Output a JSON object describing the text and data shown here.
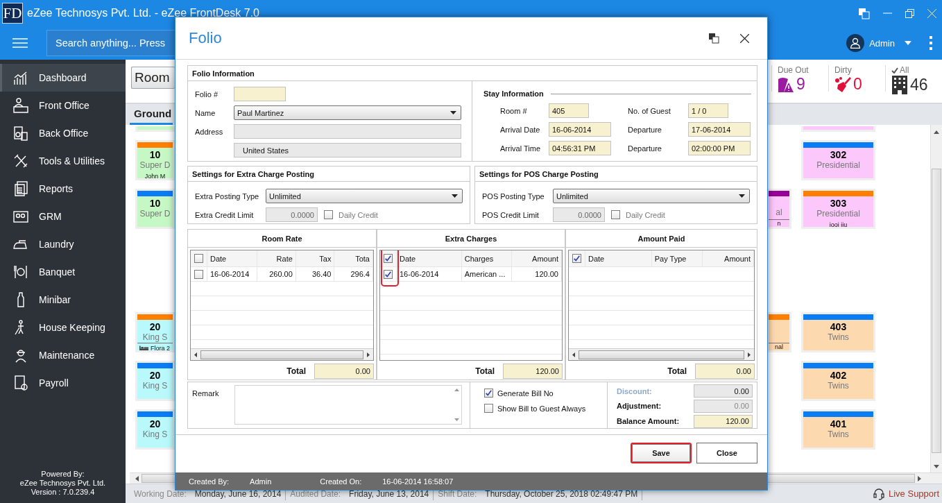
{
  "window": {
    "logo": "FD",
    "title": "eZee Technosys Pvt. Ltd. - eZee FrontDesk 7.0"
  },
  "header": {
    "search_placeholder": "Search anything... Press",
    "user": "Admin"
  },
  "sidebar": {
    "items": [
      {
        "label": "Dashboard",
        "selected": true
      },
      {
        "label": "Front Office",
        "selected": false
      },
      {
        "label": "Back Office",
        "selected": false
      },
      {
        "label": "Tools & Utilities",
        "selected": false
      },
      {
        "label": "Reports",
        "selected": false
      },
      {
        "label": "GRM",
        "selected": false
      },
      {
        "label": "Laundry",
        "selected": false
      },
      {
        "label": "Banquet",
        "selected": false
      },
      {
        "label": "Minibar",
        "selected": false
      },
      {
        "label": "House Keeping",
        "selected": false
      },
      {
        "label": "Maintenance",
        "selected": false
      },
      {
        "label": "Payroll",
        "selected": false
      }
    ],
    "footer": [
      "Powered By:",
      "eZee Technosys Pvt. Ltd.",
      "Version : 7.0.239.4"
    ]
  },
  "toolbar": {
    "view_button": "Room",
    "stats": [
      {
        "kind": "due_out",
        "label": "Due Out",
        "value": "9",
        "color": "#9a1aa0"
      },
      {
        "kind": "dirty",
        "label": "Dirty",
        "value": "0",
        "color": "#e0103a"
      },
      {
        "kind": "all",
        "label": "All",
        "value": "46",
        "color": "#333333"
      }
    ]
  },
  "floor_tabs": [
    {
      "label": "Ground",
      "selected": true
    }
  ],
  "board": {
    "blocks": [
      {
        "rows": [
          {
            "left": {
              "kind": "partial",
              "color": "#c6f8c6"
            },
            "right": {
              "kind": "partial",
              "color": "#fcc8fc"
            }
          },
          {
            "left": {
              "kind": "room",
              "number": "10",
              "type": "Super D",
              "guest": "John M",
              "color": "#c6f8c6",
              "occupied": false,
              "status": {
                "color": "#ff7f00"
              }
            },
            "right": {
              "kind": "room",
              "number": "302",
              "type": "Presidential",
              "color": "#fcc8fc",
              "occupied": false,
              "status": {
                "color": "#0a7df5"
              }
            }
          },
          {
            "left": {
              "kind": "room",
              "number": "10",
              "type": "Super D",
              "color": "#c6f8c6",
              "occupied": false,
              "status": {
                "color": "#0a7df5"
              }
            },
            "middle": {
              "kind": "room",
              "type": "al",
              "guest": "n",
              "color": "#fcc8fc",
              "occupied": true,
              "status": {
                "color": "#990099"
              }
            },
            "right": {
              "kind": "room",
              "number": "303",
              "type": "Presidential",
              "guest": "iooi iiu",
              "color": "#fcc8fc",
              "occupied": false,
              "status": {
                "color": "#ff7f00"
              }
            }
          }
        ]
      },
      {
        "rows": [
          {
            "left": {
              "kind": "room",
              "number": "20",
              "type": "King S",
              "guest": "Flora 2",
              "color": "#b9f9fb",
              "occupied": true,
              "status": {
                "color": "#ff7f00"
              }
            },
            "middle": {
              "kind": "room",
              "guest": "nal",
              "color": "#fdd9b0",
              "occupied": true,
              "status": {
                "color": "#ff7f00"
              }
            },
            "right": {
              "kind": "room",
              "number": "403",
              "type": "Twins",
              "color": "#fdd9b0",
              "occupied": false,
              "status": {
                "color": "#0a7df5"
              }
            }
          },
          {
            "left": {
              "kind": "room",
              "number": "20",
              "type": "King S",
              "color": "#b9f9fb",
              "occupied": false,
              "status": {
                "color": "#0a7df5"
              }
            },
            "right": {
              "kind": "room",
              "number": "402",
              "type": "Twins",
              "color": "#fdd9b0",
              "occupied": false,
              "status": {
                "color": "#0a7df5"
              }
            }
          },
          {
            "left": {
              "kind": "room",
              "number": "20",
              "type": "King S",
              "color": "#b9f9fb",
              "occupied": false,
              "status": {
                "color": "#0a7df5"
              }
            },
            "right": {
              "kind": "room",
              "number": "401",
              "type": "Twins",
              "color": "#fdd9b0",
              "occupied": false,
              "status": {
                "color": "#0a7df5"
              }
            }
          }
        ]
      }
    ]
  },
  "dialog": {
    "title": "Folio",
    "folio_information": {
      "heading": "Folio Information",
      "folio_label": "Folio #",
      "name_label": "Name",
      "name_value": "Paul Martinez",
      "address_label": "Address",
      "country": "United States"
    },
    "stay_information": {
      "heading": "Stay Information",
      "fields": [
        {
          "label": "Room #",
          "value": "405"
        },
        {
          "label": "No. of Guest",
          "value": "1 / 0"
        },
        {
          "label": "Arrival Date",
          "value": "16-06-2014"
        },
        {
          "label": "Departure",
          "value": "17-06-2014"
        },
        {
          "label": "Arrival Time",
          "value": "04:56:31 PM"
        },
        {
          "label": "Departure",
          "value": "02:00:00 PM"
        }
      ]
    },
    "posting_settings": [
      {
        "heading": "Settings for Extra Charge Posting",
        "type_label": "Extra Posting Type",
        "type_value": "Unlimited",
        "limit_label": "Extra Credit Limit",
        "limit_value": "0.0000",
        "daily_credit_label": "Daily Credit",
        "daily_credit_checked": false
      },
      {
        "heading": "Settings for POS Charge Posting",
        "type_label": "POS Posting Type",
        "type_value": "Unlimited",
        "limit_label": "POS Credit Limit",
        "limit_value": "0.0000",
        "daily_credit_label": "Daily Credit",
        "daily_credit_checked": false
      }
    ],
    "grids": [
      {
        "title": "Room Rate",
        "header_checked": false,
        "columns": [
          "Date",
          "Rate",
          "Tax",
          "Tota"
        ],
        "rows": [
          {
            "checked": false,
            "cells": [
              "16-06-2014",
              "260.00",
              "36.40",
              "296.4"
            ]
          }
        ],
        "horizontal_scrollbar": true,
        "annotated": false,
        "total_label": "Total",
        "total": "0.00"
      },
      {
        "title": "Extra Charges",
        "header_checked": true,
        "columns": [
          "Date",
          "Charges",
          "Amount"
        ],
        "rows": [
          {
            "checked": true,
            "cells": [
              "16-06-2014",
              "American ...",
              "120.00"
            ]
          }
        ],
        "horizontal_scrollbar": false,
        "annotated": true,
        "total_label": "Total",
        "total": "120.00"
      },
      {
        "title": "Amount Paid",
        "header_checked": true,
        "columns": [
          "Date",
          "Pay Type",
          "Amount"
        ],
        "horizontal_scrollbar": true,
        "annotated": false,
        "total_label": "Total",
        "total": "0.00"
      }
    ],
    "remark_label": "Remark",
    "options": [
      {
        "label": "Generate Bill No",
        "checked": true
      },
      {
        "label": "Show Bill to Guest Always",
        "checked": false
      }
    ],
    "summary": [
      {
        "label": "Discount:",
        "value": "0.00",
        "label_disabled": true,
        "value_disabled": false,
        "highlighted": false
      },
      {
        "label": "Adjustment:",
        "value": "0.00",
        "label_disabled": false,
        "value_disabled": true,
        "highlighted": false
      },
      {
        "label": "Balance Amount:",
        "value": "120.00",
        "label_disabled": false,
        "value_disabled": false,
        "highlighted": true
      }
    ],
    "buttons": [
      {
        "label": "Save",
        "highlighted": true
      },
      {
        "label": "Close",
        "highlighted": false
      }
    ],
    "footer": [
      {
        "label": "Created By:",
        "value": "Admin"
      },
      {
        "label": "Created On:",
        "value": "16-06-2014 16:58:07"
      }
    ]
  },
  "status_bar": {
    "items": [
      {
        "label": "Working Date:",
        "value": "Monday, June 16, 2014"
      },
      {
        "label": "Audited Date:",
        "value": "Friday, June 13, 2014"
      },
      {
        "label": "Shift Date:",
        "value": "Thursday, October 25, 2018 02:49:47 PM"
      }
    ],
    "live_support": "Live Support"
  }
}
